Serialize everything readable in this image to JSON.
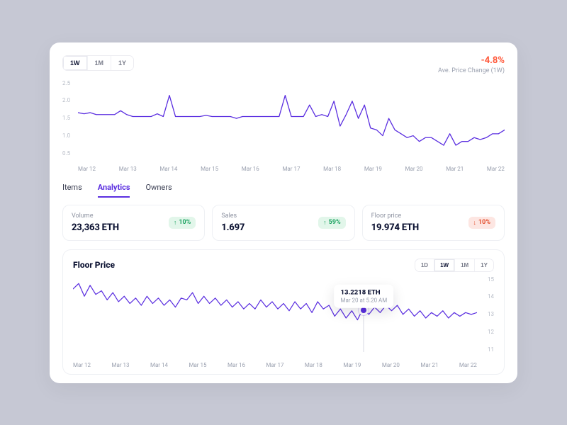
{
  "top_range": {
    "options": [
      "1W",
      "1M",
      "1Y"
    ],
    "active": "1W"
  },
  "price_change": {
    "pct": "-4.8%",
    "label": "Ave. Price Change (1W)"
  },
  "tabs": {
    "items": [
      "Items",
      "Analytics",
      "Owners"
    ],
    "active_index": 1
  },
  "stats": [
    {
      "label": "Volume",
      "value": "23,363 ETH",
      "delta": "10%",
      "dir": "up"
    },
    {
      "label": "Sales",
      "value": "1.697",
      "delta": "59%",
      "dir": "up"
    },
    {
      "label": "Floor price",
      "value": "19.974 ETH",
      "delta": "10%",
      "dir": "down"
    }
  ],
  "floor": {
    "title": "Floor Price",
    "range": {
      "options": [
        "1D",
        "1W",
        "1M",
        "1Y"
      ],
      "active": "1W"
    },
    "tooltip": {
      "value": "13.2218 ETH",
      "time": "Mar 20 at 5.20 AM"
    }
  },
  "axis": {
    "x_dates": [
      "Mar 12",
      "Mar 13",
      "Mar 14",
      "Mar 15",
      "Mar 16",
      "Mar 17",
      "Mar 18",
      "Mar 19",
      "Mar 20",
      "Mar 21",
      "Mar 22"
    ]
  },
  "chart_data": [
    {
      "type": "line",
      "title": "Ave. Price Change (1W)",
      "ylabel": "",
      "ylim": [
        0.5,
        2.5
      ],
      "y_ticks": [
        2.5,
        2.0,
        1.5,
        1.0,
        0.5
      ],
      "x": [
        "Mar 12",
        "Mar 13",
        "Mar 14",
        "Mar 15",
        "Mar 16",
        "Mar 17",
        "Mar 18",
        "Mar 19",
        "Mar 20",
        "Mar 21",
        "Mar 22"
      ],
      "series": [
        {
          "name": "price",
          "values": [
            1.65,
            1.62,
            1.65,
            1.6,
            1.6,
            1.6,
            1.6,
            1.7,
            1.6,
            1.55,
            1.55,
            1.55,
            1.55,
            1.62,
            1.55,
            2.1,
            1.55,
            1.55,
            1.55,
            1.55,
            1.55,
            1.58,
            1.55,
            1.55,
            1.55,
            1.55,
            1.5,
            1.55,
            1.55,
            1.55,
            1.55,
            1.55,
            1.55,
            1.55,
            2.1,
            1.55,
            1.55,
            1.55,
            1.85,
            1.55,
            1.6,
            1.55,
            1.95,
            1.3,
            1.6,
            1.95,
            1.5,
            1.85,
            1.25,
            1.2,
            1.05,
            1.5,
            1.2,
            1.1,
            1.0,
            1.05,
            0.9,
            1.0,
            1.0,
            0.9,
            0.8,
            1.1,
            0.8,
            0.9,
            0.9,
            1.0,
            0.95,
            1.0,
            1.1,
            1.1,
            1.2
          ]
        }
      ]
    },
    {
      "type": "line",
      "title": "Floor Price",
      "ylabel": "",
      "ylim": [
        11,
        15
      ],
      "y_ticks": [
        15,
        14,
        13,
        12,
        11
      ],
      "x": [
        "Mar 12",
        "Mar 13",
        "Mar 14",
        "Mar 15",
        "Mar 16",
        "Mar 17",
        "Mar 18",
        "Mar 19",
        "Mar 20",
        "Mar 21",
        "Mar 22"
      ],
      "highlight": {
        "x_frac": 0.72,
        "y": 13.22,
        "value_label": "13.2218 ETH",
        "time_label": "Mar 20 at 5.20 AM"
      },
      "series": [
        {
          "name": "floor",
          "values": [
            14.3,
            14.6,
            13.9,
            14.5,
            14.0,
            14.2,
            13.7,
            14.1,
            13.6,
            13.9,
            13.5,
            13.8,
            13.4,
            13.9,
            13.5,
            13.8,
            13.4,
            13.7,
            13.3,
            13.8,
            13.7,
            14.1,
            13.5,
            13.9,
            13.5,
            13.8,
            13.4,
            13.7,
            13.3,
            13.6,
            13.2,
            13.5,
            13.2,
            13.7,
            13.3,
            13.6,
            13.2,
            13.5,
            13.1,
            13.6,
            13.2,
            13.5,
            13.0,
            13.6,
            13.2,
            13.4,
            12.8,
            13.2,
            12.7,
            13.1,
            12.6,
            13.22,
            12.9,
            13.3,
            13.0,
            13.4,
            13.1,
            13.4,
            12.9,
            13.2,
            12.8,
            13.1,
            12.7,
            13.0,
            12.8,
            13.1,
            12.7,
            13.0,
            12.8,
            13.0,
            12.9,
            13.0
          ]
        }
      ]
    }
  ]
}
